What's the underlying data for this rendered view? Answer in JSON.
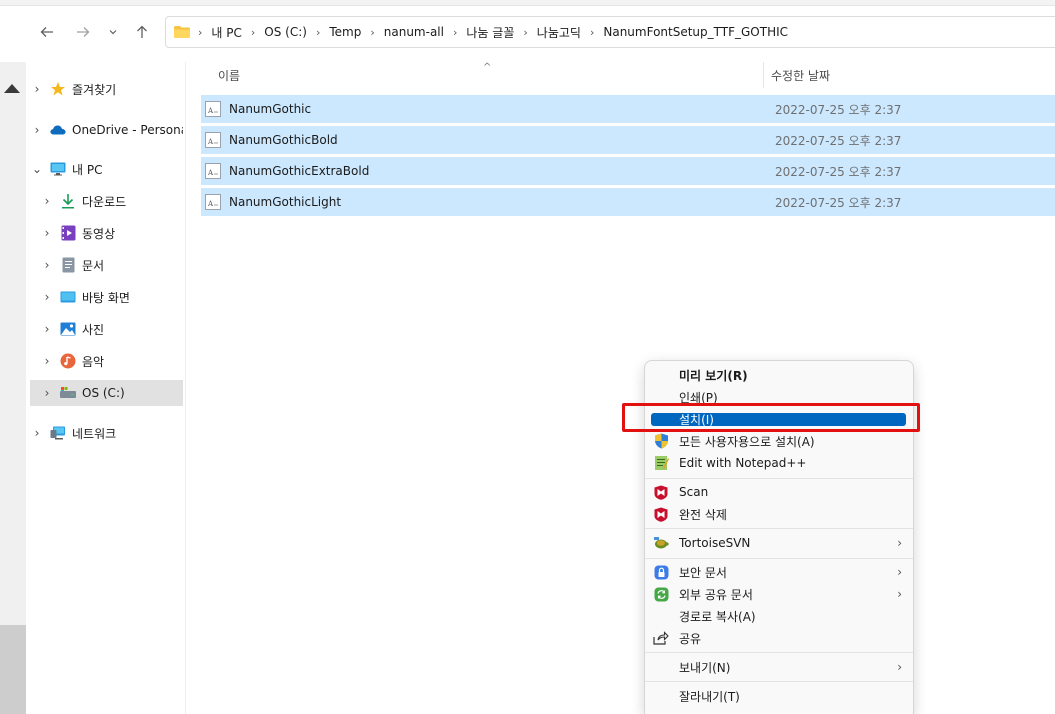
{
  "address": {
    "crumbs": [
      "내 PC",
      "OS (C:)",
      "Temp",
      "nanum-all",
      "나눔 글꼴",
      "나눔고딕",
      "NanumFontSetup_TTF_GOTHIC"
    ]
  },
  "nav": {
    "back": "←",
    "forward": "→",
    "recent": "⌄",
    "up": "↑"
  },
  "sidebar": {
    "items": [
      {
        "label": "즐겨찾기",
        "icon": "star-icon",
        "chevron": "›"
      },
      {
        "label": "OneDrive - Persona",
        "icon": "cloud-icon",
        "chevron": "›"
      },
      {
        "label": "내 PC",
        "icon": "pc-icon",
        "chevron": "⌄"
      },
      {
        "label": "다운로드",
        "icon": "download-icon",
        "chevron": "›"
      },
      {
        "label": "동영상",
        "icon": "video-icon",
        "chevron": "›"
      },
      {
        "label": "문서",
        "icon": "document-icon",
        "chevron": "›"
      },
      {
        "label": "바탕 화면",
        "icon": "desktop-icon",
        "chevron": "›"
      },
      {
        "label": "사진",
        "icon": "picture-icon",
        "chevron": "›"
      },
      {
        "label": "음악",
        "icon": "music-icon",
        "chevron": "›"
      },
      {
        "label": "OS (C:)",
        "icon": "drive-icon",
        "chevron": "›"
      },
      {
        "label": "네트워크",
        "icon": "network-icon",
        "chevron": "›"
      }
    ]
  },
  "list": {
    "columns": {
      "name": "이름",
      "date": "수정한 날짜"
    },
    "sort_indicator": "^",
    "rows": [
      {
        "name": "NanumGothic",
        "date": "2022-07-25 오후 2:37"
      },
      {
        "name": "NanumGothicBold",
        "date": "2022-07-25 오후 2:37"
      },
      {
        "name": "NanumGothicExtraBold",
        "date": "2022-07-25 오후 2:37"
      },
      {
        "name": "NanumGothicLight",
        "date": "2022-07-25 오후 2:37"
      }
    ]
  },
  "context_menu": {
    "items": [
      {
        "label": "미리 보기(R)"
      },
      {
        "label": "인쇄(P)"
      },
      {
        "label": "설치(I)"
      },
      {
        "label": "모든 사용자용으로 설치(A)",
        "icon": "shield-icon"
      },
      {
        "label": "Edit with Notepad++",
        "icon": "notepad-icon"
      },
      {
        "label": "Scan",
        "icon": "mcafee-icon"
      },
      {
        "label": "완전 삭제",
        "icon": "mcafee-icon"
      },
      {
        "label": "TortoiseSVN",
        "icon": "tortoise-icon",
        "arrow": "›"
      },
      {
        "label": "보안 문서",
        "icon": "lock-icon",
        "arrow": "›"
      },
      {
        "label": "외부 공유 문서",
        "icon": "share-sync-icon",
        "arrow": "›"
      },
      {
        "label": "경로로 복사(A)"
      },
      {
        "label": "공유",
        "icon": "share-icon"
      },
      {
        "label": "보내기(N)",
        "arrow": "›"
      },
      {
        "label": "잘라내기(T)"
      }
    ]
  },
  "colors": {
    "selection": "#cce8ff",
    "highlight": "#0067c0",
    "annotation": "#e31010"
  }
}
